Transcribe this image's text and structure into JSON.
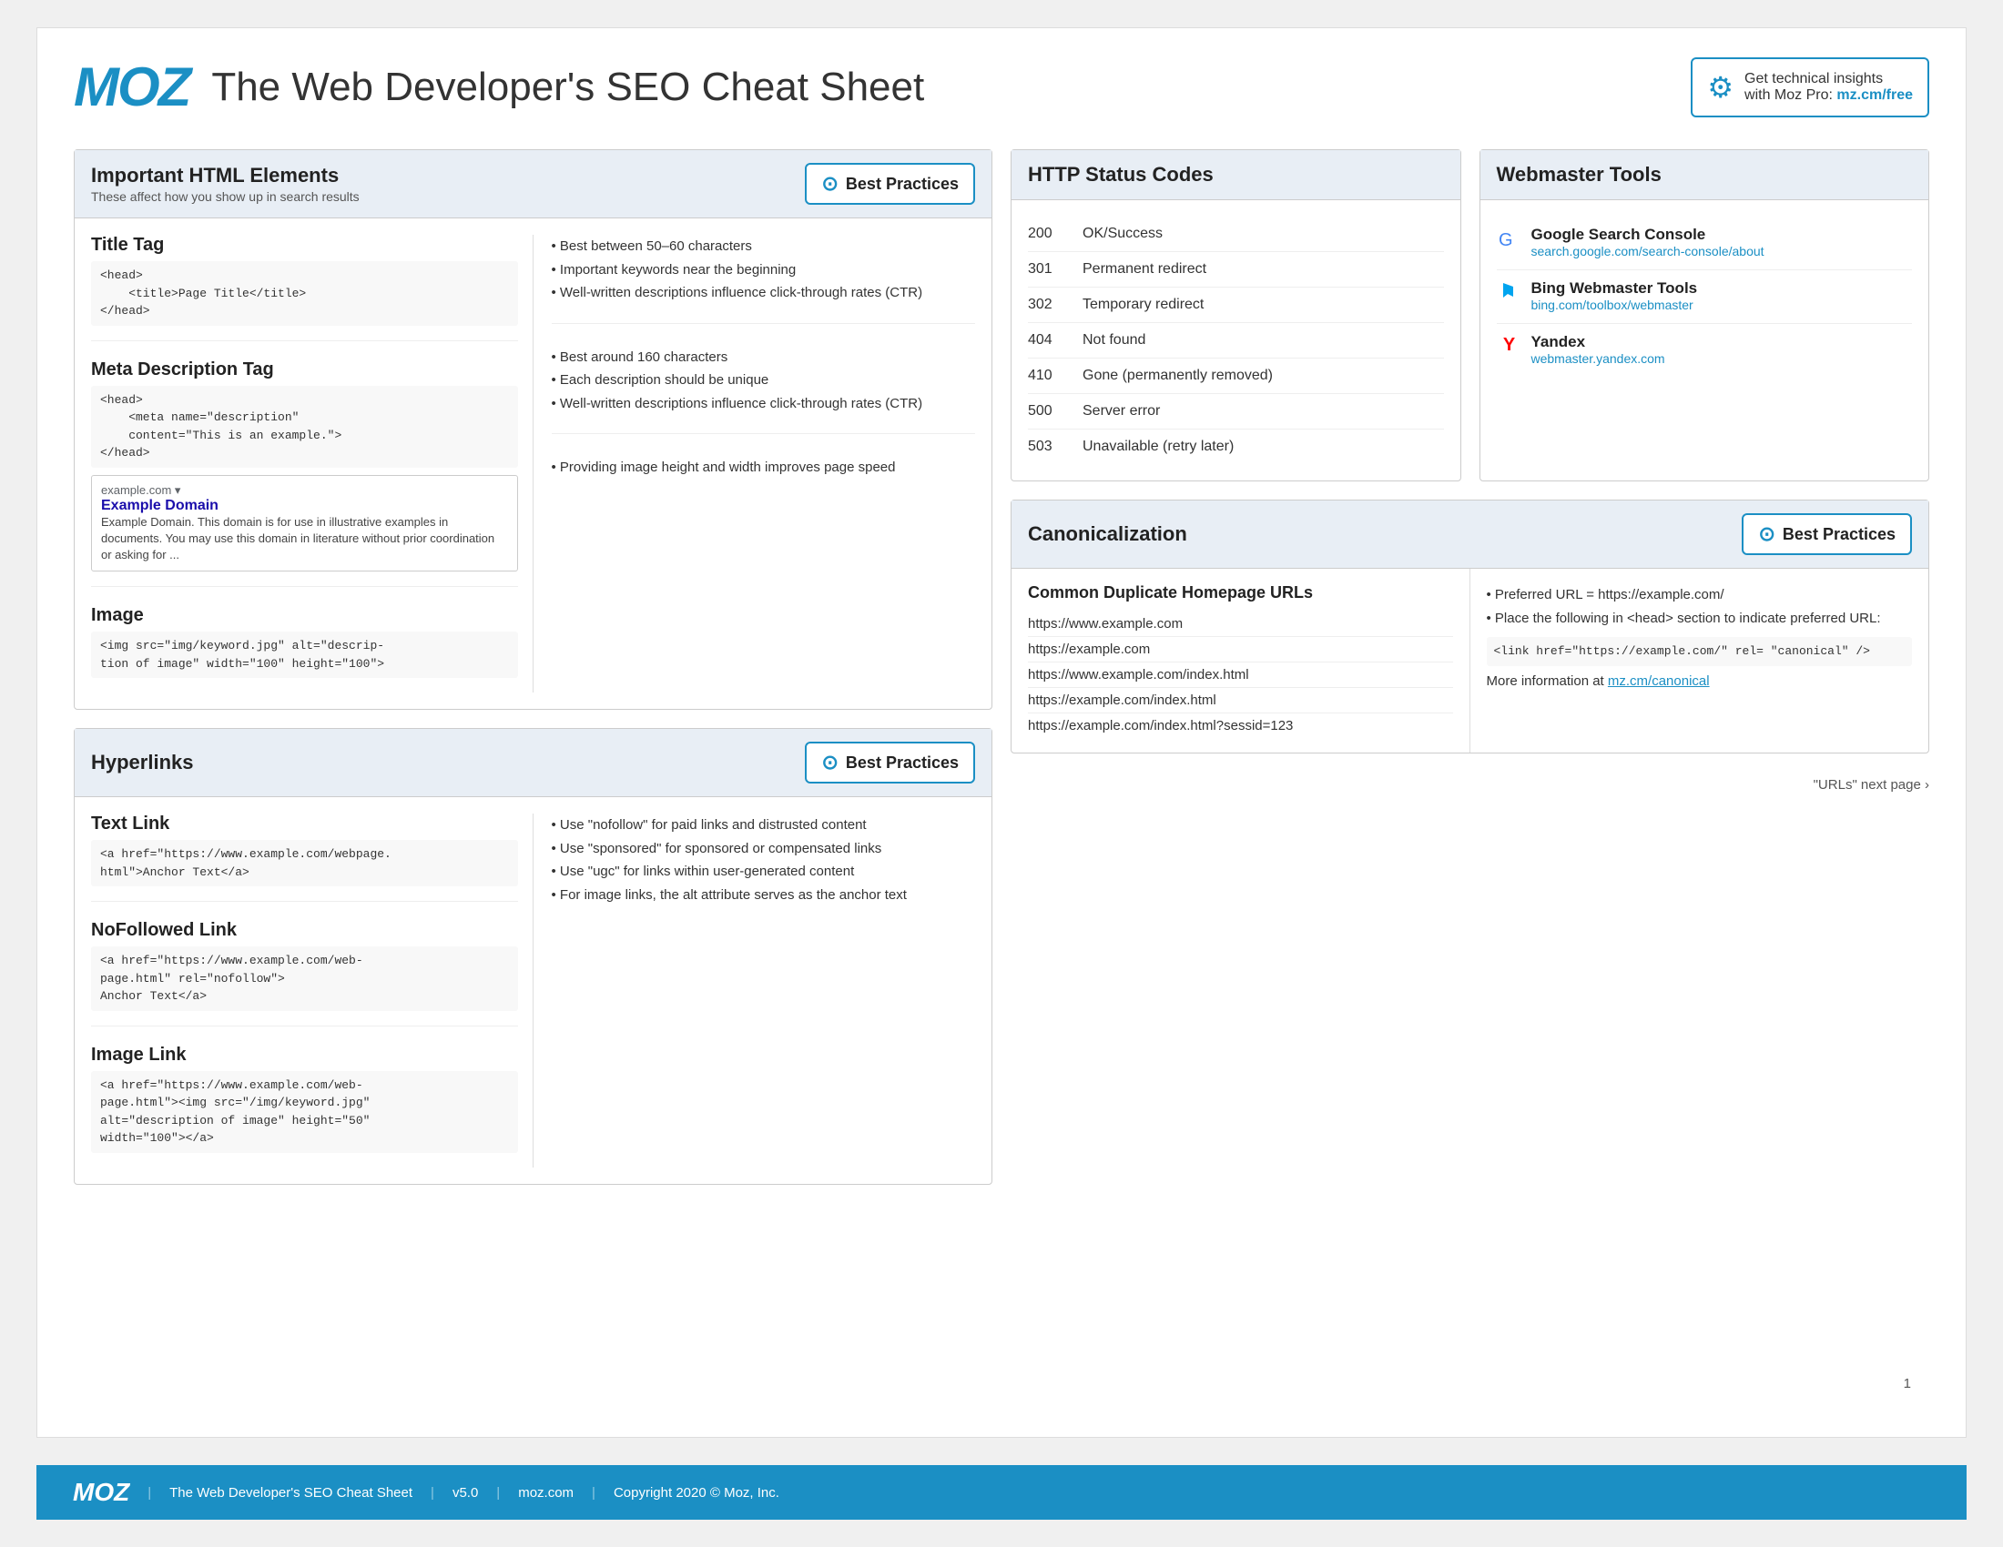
{
  "header": {
    "logo": "MOZ",
    "title": "The Web Developer's SEO Cheat Sheet",
    "promo_line1": "Get technical insights",
    "promo_line2": "with Moz Pro:",
    "promo_link": "mz.cm/free"
  },
  "html_elements": {
    "panel_title": "Important HTML Elements",
    "panel_sub": "These affect how you show up in search results",
    "best_practices_label": "Best Practices",
    "title_tag": {
      "heading": "Title Tag",
      "code": "<head>\n    <title>Page Title</title>\n</head>",
      "tips": [
        "Best between 50–60 characters",
        "Important keywords near the beginning",
        "Well-written descriptions influence click-through rates (CTR)"
      ]
    },
    "meta_desc": {
      "heading": "Meta Description Tag",
      "code": "<head>\n    <meta name=\"description\"\n    content=\"This is an example.\">\n</head>",
      "tips": [
        "Best around 160 characters",
        "Each description should be unique",
        "Well-written descriptions influence click-through rates (CTR)"
      ],
      "search_preview": {
        "url": "example.com ▾",
        "title": "Example Domain",
        "desc": "Example Domain. This domain is for use in illustrative examples in documents. You may use this domain in literature without prior coordination or asking for ..."
      }
    },
    "image": {
      "heading": "Image",
      "code": "<img src=\"img/keyword.jpg\" alt=\"descrip-\ntion of image\" width=\"100\" height=\"100\">",
      "tips": [
        "Providing image height and width improves page speed"
      ]
    }
  },
  "http_status": {
    "panel_title": "HTTP Status Codes",
    "codes": [
      {
        "code": "200",
        "desc": "OK/Success"
      },
      {
        "code": "301",
        "desc": "Permanent redirect"
      },
      {
        "code": "302",
        "desc": "Temporary redirect"
      },
      {
        "code": "404",
        "desc": "Not found"
      },
      {
        "code": "410",
        "desc": "Gone (permanently removed)"
      },
      {
        "code": "500",
        "desc": "Server error"
      },
      {
        "code": "503",
        "desc": "Unavailable (retry later)"
      }
    ]
  },
  "webmaster_tools": {
    "panel_title": "Webmaster Tools",
    "tools": [
      {
        "name": "Google Search Console",
        "url": "search.google.com/search-console/about",
        "icon": "G"
      },
      {
        "name": "Bing Webmaster Tools",
        "url": "bing.com/toolbox/webmaster",
        "icon": "B"
      },
      {
        "name": "Yandex",
        "url": "webmaster.yandex.com",
        "icon": "Y"
      }
    ]
  },
  "hyperlinks": {
    "panel_title": "Hyperlinks",
    "best_practices_label": "Best Practices",
    "text_link": {
      "heading": "Text Link",
      "code": "<a href=\"https://www.example.com/webpage.\nhtml\">Anchor Text</a>"
    },
    "nofollowed": {
      "heading": "NoFollowed Link",
      "code": "<a href=\"https://www.example.com/web-\npage.html\" rel=\"nofollow\">\nAnchor Text</a>"
    },
    "image_link": {
      "heading": "Image Link",
      "code": "<a href=\"https://www.example.com/web-\npage.html\"><img src=\"/img/keyword.jpg\"\nalt=\"description of image\" height=\"50\"\nwidth=\"100\"></a>"
    },
    "tips": [
      "Use \"nofollow\" for paid links and distrusted content",
      "Use \"sponsored\" for sponsored or compensated links",
      "Use \"ugc\" for links within user-generated content",
      "For image links, the alt attribute serves as the anchor text"
    ]
  },
  "canonicalization": {
    "panel_title": "Canonicalization",
    "best_practices_label": "Best Practices",
    "duplicate_title": "Common Duplicate Homepage URLs",
    "urls": [
      "https://www.example.com",
      "https://example.com",
      "https://www.example.com/index.html",
      "https://example.com/index.html",
      "https://example.com/index.html?sessid=123"
    ],
    "tips": [
      "Preferred URL = https://example.com/",
      "Place the following in <head> section to indicate preferred URL:"
    ],
    "canon_code": "<link href=\"https://example.com/\" rel=\n\"canonical\" />",
    "more_info": "More information at ",
    "more_link": "mz.cm/canonical"
  },
  "footer": {
    "logo": "MOZ",
    "tagline": "The Web Developer's SEO Cheat Sheet",
    "version": "v5.0",
    "site": "moz.com",
    "copyright": "Copyright 2020 © Moz, Inc.",
    "next_page": "\"URLs\" next page ›",
    "page_num": "1"
  }
}
